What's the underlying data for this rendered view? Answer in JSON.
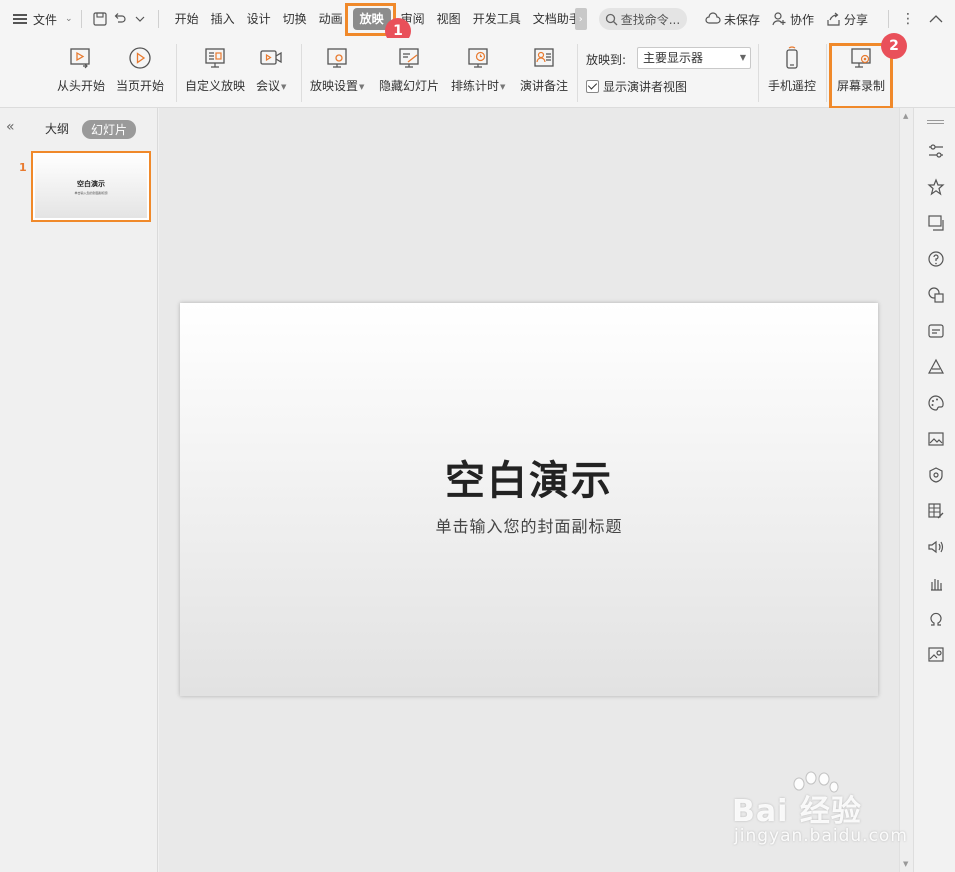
{
  "menubar": {
    "file_label": "文件",
    "tabs": [
      "开始",
      "插入",
      "设计",
      "切换",
      "动画",
      "放映",
      "审阅",
      "视图",
      "开发工具",
      "文档助手"
    ],
    "active_tab": "放映",
    "search_placeholder": "查找命令...",
    "unsaved": "未保存",
    "collab": "协作",
    "share": "分享"
  },
  "ribbon": {
    "from_start": "从头开始",
    "from_current": "当页开始",
    "custom_show": "自定义放映",
    "meeting": "会议",
    "show_settings": "放映设置",
    "hide_slide": "隐藏幻灯片",
    "rehearse": "排练计时",
    "speaker_notes": "演讲备注",
    "play_to_label": "放映到:",
    "play_to_value": "主要显示器",
    "presenter_view": "显示演讲者视图",
    "phone_remote": "手机遥控",
    "screen_record": "屏幕录制"
  },
  "badges": [
    "1",
    "2"
  ],
  "leftpanel": {
    "outline_tab": "大纲",
    "slides_tab": "幻灯片",
    "thumb_number": "1"
  },
  "slide": {
    "title": "空白演示",
    "subtitle": "单击输入您的封面副标题"
  },
  "watermark": {
    "main": "Bai 经验",
    "sub": "jingyan.baidu.com"
  },
  "colors": {
    "highlight": "#f0892a",
    "badge": "#e9505a",
    "active_tab_bg": "#8c8c8c"
  }
}
